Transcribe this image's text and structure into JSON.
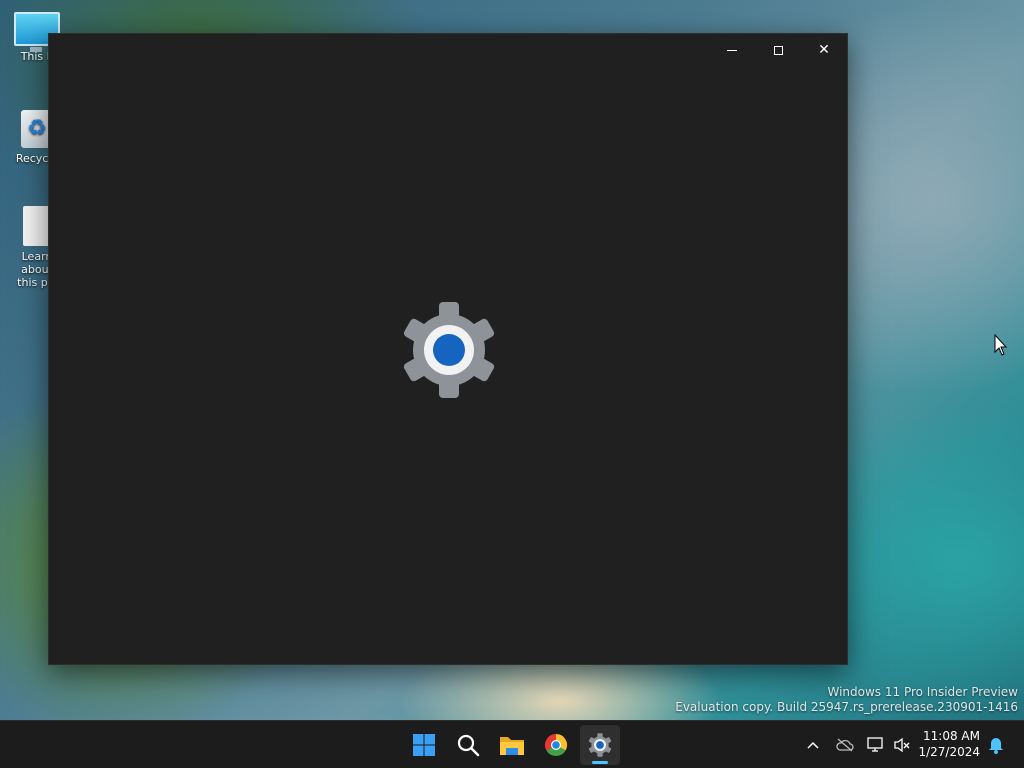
{
  "desktop": {
    "icons": [
      {
        "label": "This P"
      },
      {
        "label": "Recycle"
      },
      {
        "label": "Learn about this pic"
      }
    ]
  },
  "window": {
    "title": "",
    "minimize_label": "",
    "maximize_label": "",
    "close_label": "✕"
  },
  "watermark": {
    "line1": "Windows 11 Pro Insider Preview",
    "line2": "Evaluation copy. Build 25947.rs_prerelease.230901-1416"
  },
  "clock": {
    "time": "11:08 AM",
    "date": "1/27/2024"
  },
  "taskbar": {
    "apps": [
      {
        "name": "Start"
      },
      {
        "name": "Search"
      },
      {
        "name": "File Explorer"
      },
      {
        "name": "Google Chrome"
      },
      {
        "name": "Settings",
        "active": true
      }
    ]
  },
  "colors": {
    "accent": "#4cc2ff",
    "gear_center": "#1565c0",
    "window_bg": "#202020",
    "taskbar_bg": "#1c1c1c"
  }
}
